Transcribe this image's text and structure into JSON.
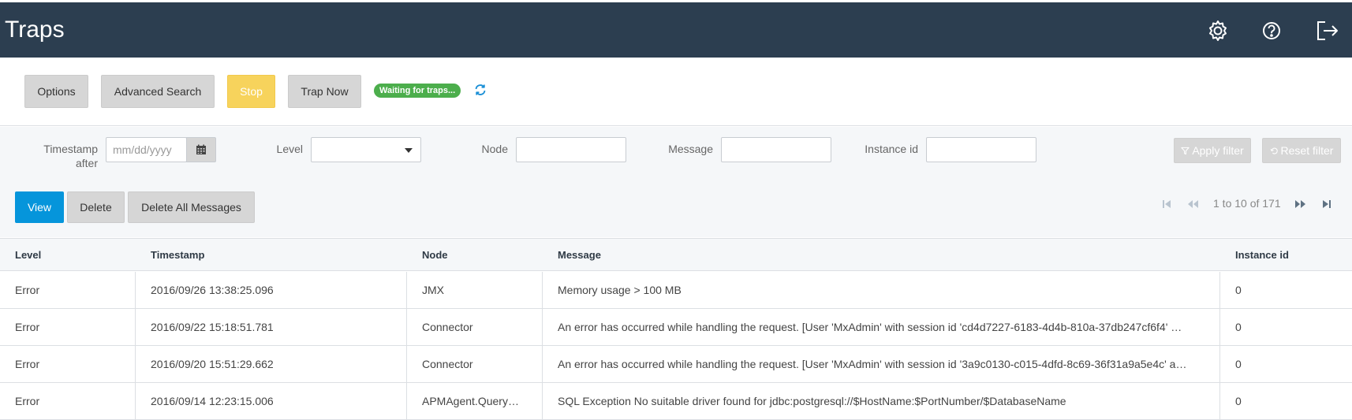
{
  "header": {
    "title": "Traps",
    "icons": [
      "gear-icon",
      "help-icon",
      "logout-icon"
    ]
  },
  "toolbar": {
    "options_label": "Options",
    "advanced_search_label": "Advanced Search",
    "stop_label": "Stop",
    "trap_now_label": "Trap Now",
    "status_text": "Waiting for traps...",
    "colors": {
      "stop": "#f7d35c",
      "status": "#4cae4c"
    }
  },
  "filters": {
    "timestamp_label_line1": "Timestamp",
    "timestamp_label_line2": "after",
    "timestamp_placeholder": "mm/dd/yyyy",
    "level_label": "Level",
    "level_value": "",
    "node_label": "Node",
    "node_value": "",
    "message_label": "Message",
    "message_value": "",
    "instance_label": "Instance id",
    "instance_value": "",
    "apply_label": "Apply filter",
    "reset_label": "Reset filter"
  },
  "actions": {
    "view_label": "View",
    "delete_label": "Delete",
    "delete_all_label": "Delete All Messages",
    "colors": {
      "view": "#0595db"
    }
  },
  "pager": {
    "text": "1 to 10 of 171"
  },
  "table": {
    "columns": [
      "Level",
      "Timestamp",
      "Node",
      "Message",
      "Instance id"
    ],
    "rows": [
      [
        "Error",
        "2016/09/26 13:38:25.096",
        "JMX",
        "Memory usage > 100 MB",
        "0"
      ],
      [
        "Error",
        "2016/09/22 15:18:51.781",
        "Connector",
        "An error has occurred while handling the request. [User 'MxAdmin' with session id 'cd4d7227-6183-4d4b-810a-37db247cf6f4' …",
        "0"
      ],
      [
        "Error",
        "2016/09/20 15:51:29.662",
        "Connector",
        "An error has occurred while handling the request. [User 'MxAdmin' with session id '3a9c0130-c015-4dfd-8c69-36f31a9a5e4c' a…",
        "0"
      ],
      [
        "Error",
        "2016/09/14 12:23:15.006",
        "APMAgent.Query…",
        "SQL Exception No suitable driver found for jdbc:postgresql://$HostName:$PortNumber/$DatabaseName",
        "0"
      ]
    ]
  }
}
